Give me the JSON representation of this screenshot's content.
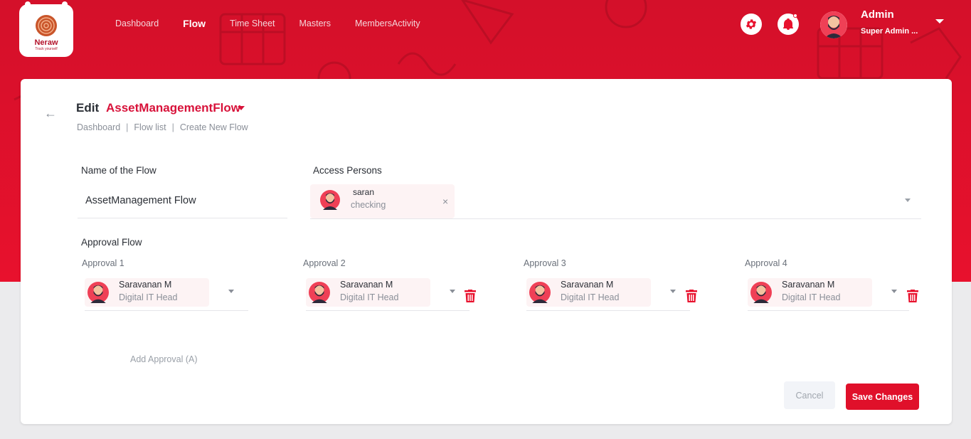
{
  "brand": {
    "name": "Neraw",
    "tagline": "Track yourself"
  },
  "nav": [
    {
      "label": "Dashboard",
      "active": false
    },
    {
      "label": "Flow",
      "active": true
    },
    {
      "label": "Time Sheet",
      "active": false
    },
    {
      "label": "Masters",
      "active": false
    },
    {
      "label": "MembersActivity",
      "active": false
    }
  ],
  "header": {
    "settings_icon": "gear-icon",
    "notification_icon": "bell-icon",
    "user": {
      "name": "Admin",
      "role": "Super Admin ..."
    }
  },
  "page": {
    "edit_label": "Edit",
    "flow_selected": "AssetManagementFlow",
    "breadcrumb": [
      "Dashboard",
      "Flow list",
      "Create New Flow"
    ]
  },
  "form": {
    "name_label": "Name of the Flow",
    "name_value": "AssetManagement Flow",
    "access_label": "Access Persons",
    "access_persons": [
      {
        "name": "saran",
        "sub": "checking"
      }
    ],
    "approval_flow_label": "Approval Flow",
    "approvals": [
      {
        "label": "Approval 1",
        "name": "Saravanan M",
        "role": "Digital IT Head",
        "deletable": false
      },
      {
        "label": "Approval 2",
        "name": "Saravanan M",
        "role": "Digital IT Head",
        "deletable": true
      },
      {
        "label": "Approval 3",
        "name": "Saravanan M",
        "role": "Digital IT Head",
        "deletable": true
      },
      {
        "label": "Approval 4",
        "name": "Saravanan M",
        "role": "Digital IT Head",
        "deletable": true
      }
    ],
    "add_approval": "Add Approval (A)",
    "cancel": "Cancel",
    "save": "Save Changes"
  },
  "colors": {
    "primary": "#e8112d",
    "accent_text": "#d8123a",
    "chip_bg": "#fdf3f4"
  }
}
